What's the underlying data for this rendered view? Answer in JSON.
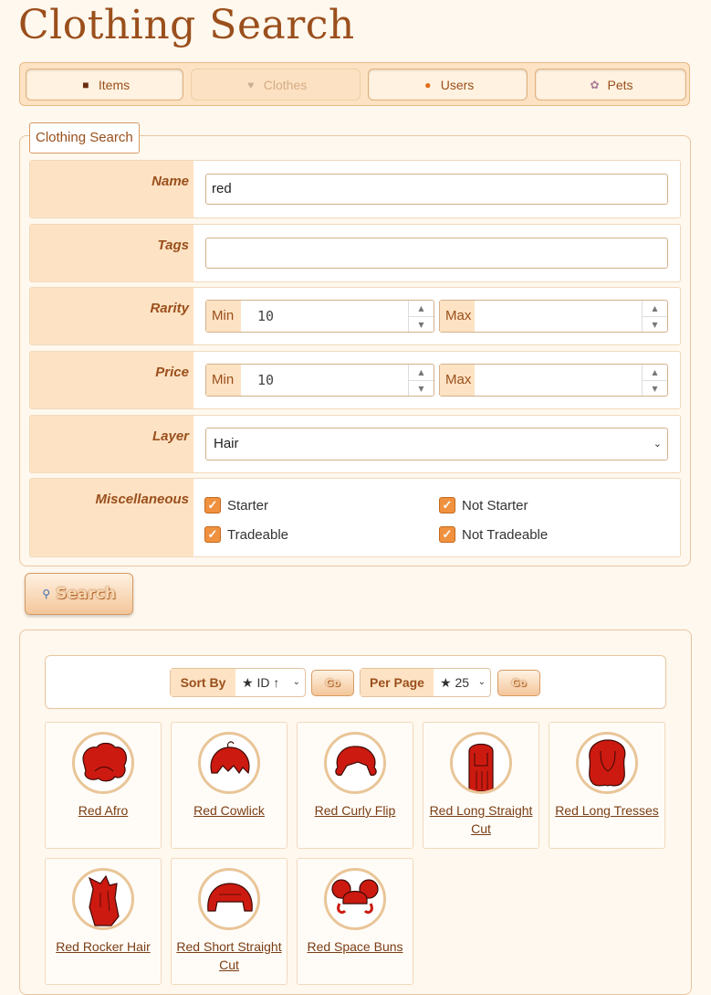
{
  "page_title": "Clothing Search",
  "tabs": [
    {
      "label": "Items",
      "icon": "box-icon",
      "active": false
    },
    {
      "label": "Clothes",
      "icon": "clothes-icon",
      "active": true
    },
    {
      "label": "Users",
      "icon": "user-icon",
      "active": false
    },
    {
      "label": "Pets",
      "icon": "pet-icon",
      "active": false
    }
  ],
  "form": {
    "legend": "Clothing Search",
    "name": {
      "label": "Name",
      "value": "red"
    },
    "tags": {
      "label": "Tags",
      "value": ""
    },
    "rarity": {
      "label": "Rarity",
      "min_label": "Min",
      "min_value": "10",
      "max_label": "Max",
      "max_value": ""
    },
    "price": {
      "label": "Price",
      "min_label": "Min",
      "min_value": "10",
      "max_label": "Max",
      "max_value": ""
    },
    "layer": {
      "label": "Layer",
      "value": "Hair"
    },
    "misc": {
      "label": "Miscellaneous",
      "starter": "Starter",
      "not_starter": "Not Starter",
      "tradeable": "Tradeable",
      "not_tradeable": "Not Tradeable"
    },
    "search_button": "Search"
  },
  "results": {
    "sort_label": "Sort By",
    "sort_value": "★ ID ↑",
    "per_page_label": "Per Page",
    "per_page_value": "★ 25",
    "go_label": "Go",
    "items": [
      {
        "name": "Red Afro"
      },
      {
        "name": "Red Cowlick"
      },
      {
        "name": "Red Curly Flip"
      },
      {
        "name": "Red Long Straight Cut"
      },
      {
        "name": "Red Long Tresses"
      },
      {
        "name": "Red Rocker Hair"
      },
      {
        "name": "Red Short Straight Cut"
      },
      {
        "name": "Red Space Buns"
      }
    ]
  },
  "colors": {
    "accent": "#9a4f1c",
    "hair": "#cc1a10",
    "panel": "#fde3c4"
  }
}
